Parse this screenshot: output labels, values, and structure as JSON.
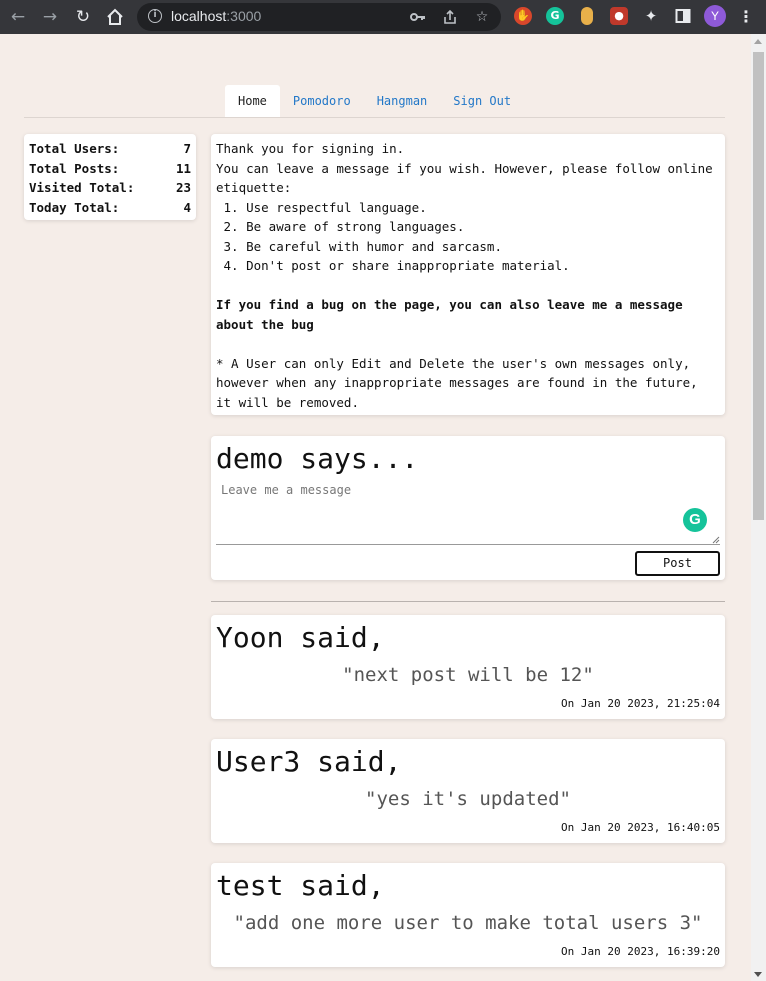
{
  "browser": {
    "url_host": "localhost",
    "url_port": ":3000",
    "profile_initial": "Y"
  },
  "nav": {
    "tabs": [
      {
        "label": "Home",
        "active": true
      },
      {
        "label": "Pomodoro",
        "active": false
      },
      {
        "label": "Hangman",
        "active": false
      },
      {
        "label": "Sign Out",
        "active": false
      }
    ]
  },
  "stats": [
    {
      "label": "Total Users:",
      "value": "7"
    },
    {
      "label": "Total Posts:",
      "value": "11"
    },
    {
      "label": "Visited Total:",
      "value": "23"
    },
    {
      "label": "Today Total:",
      "value": "4"
    }
  ],
  "info": {
    "lines": [
      "Thank you for signing in.",
      "You can leave a message if you wish. However, please follow online etiquette:",
      " 1. Use respectful language.",
      " 2. Be aware of strong languages.",
      " 3. Be careful with humor and sarcasm.",
      " 4. Don't post or share inappropriate material."
    ],
    "bug_note": "If you find a bug on the page, you can also leave me a message about the bug",
    "footnote": "* A User can only Edit and Delete the user's own messages only, however when any inappropriate messages are found in the future, it will be removed."
  },
  "composer": {
    "heading": "demo says...",
    "placeholder": "Leave me a message",
    "post_label": "Post"
  },
  "messages": [
    {
      "author": "Yoon said,",
      "text": "\"next post will be 12\"",
      "date": "On Jan 20 2023, 21:25:04"
    },
    {
      "author": "User3 said,",
      "text": "\"yes it's updated\"",
      "date": "On Jan 20 2023, 16:40:05"
    },
    {
      "author": "test said,",
      "text": "\"add one more user to make total users 3\"",
      "date": "On Jan 20 2023, 16:39:20"
    }
  ],
  "colors": {
    "page_bg": "#f5ede8",
    "link": "#2378c8",
    "grammarly": "#15c39a"
  },
  "icons": [
    "back-icon",
    "forward-icon",
    "reload-icon",
    "home-icon",
    "info-icon",
    "key-icon",
    "share-icon",
    "star-icon",
    "extensions-icon",
    "sidepanel-icon",
    "menu-icon"
  ]
}
